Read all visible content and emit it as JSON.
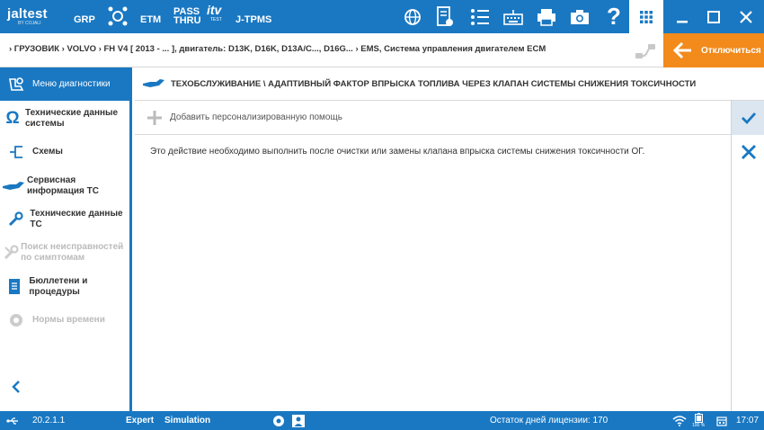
{
  "toolbar": {
    "logo_main": "jaltest",
    "logo_sub": "BY COJALI",
    "grp_label": "GRP",
    "etm_label": "ETM",
    "pass_line1": "PASS",
    "pass_line2": "THRU",
    "itv_label": "itv",
    "itv_sub": "TEST",
    "tpms_label": "J-TPMS"
  },
  "breadcrumb": {
    "text": "› ГРУЗОВИК › VOLVO › FH V4 [ 2013 - ... ], двигатель: D13K, D16K, D13A/C..., D16G... › EMS, Система управления двигателем ECM",
    "disconnect_label": "Отключиться"
  },
  "sidebar": {
    "items": [
      {
        "label": "Меню диагностики",
        "icon": "vehicle-diagnosis-icon",
        "active": true
      },
      {
        "label": "Технические данные системы",
        "icon": "omega-icon"
      },
      {
        "label": "Схемы",
        "icon": "schematics-icon"
      },
      {
        "label": "Сервисная информация ТС",
        "icon": "oil-can-icon"
      },
      {
        "label": "Технические данные ТС",
        "icon": "wrench-icon"
      },
      {
        "label": "Поиск неисправностей по симптомам",
        "icon": "troubleshoot-icon",
        "disabled": true
      },
      {
        "label": "Бюллетени и процедуры",
        "icon": "bulletin-icon"
      },
      {
        "label": "Нормы времени",
        "icon": "time-norms-icon",
        "disabled": true
      }
    ]
  },
  "main": {
    "title": "ТЕХОБСЛУЖИВАНИЕ \\ АДАПТИВНЫЙ ФАКТОР ВПРЫСКА ТОПЛИВА ЧЕРЕЗ КЛАПАН СИСТЕМЫ СНИЖЕНИЯ ТОКСИЧНОСТИ",
    "add_help_label": "Добавить персонализированную помощь",
    "body": "Это действие необходимо выполнить после очистки или замены клапана впрыска системы снижения токсичности ОГ."
  },
  "status": {
    "version": "20.2.1.1",
    "mode": "Expert",
    "simulation": "Simulation",
    "license": "Остаток дней лицензии: 170",
    "battery_pct": "100 %",
    "time": "17:07"
  },
  "colors": {
    "primary": "#1a78c2",
    "accent": "#f28a1c",
    "active_bg": "#1a78c2"
  }
}
